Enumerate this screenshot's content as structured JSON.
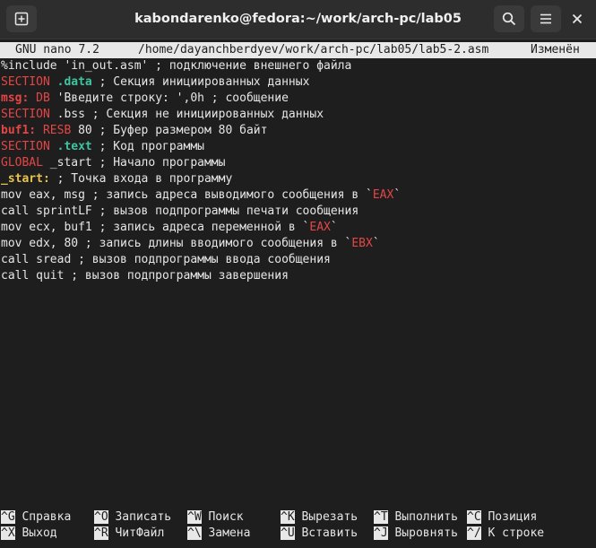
{
  "window": {
    "title": "kabondarenko@fedora:~/work/arch-pc/lab05",
    "new_tab_icon": "new-tab-icon",
    "search_icon": "search-icon",
    "menu_icon": "hamburger-menu-icon",
    "close_icon": "close-icon"
  },
  "nano": {
    "version": "GNU nano 7.2",
    "file_path": "/home/dayanchberdyev/work/arch-pc/lab05/lab5-2.asm",
    "status": "Изменён"
  },
  "code": {
    "l1": {
      "a": "%include 'in_out.asm' ; подключение внешнего файла"
    },
    "l2": {
      "a": "SECTION",
      "b": ".data",
      "c": " ; Секция инициированных данных"
    },
    "l3": {
      "a": "msg:",
      "b": " DB",
      "c": " 'Введите строку: ',0h ; сообщение"
    },
    "l4": {
      "a": "SECTION",
      "b": " .bss ; Секция не инициированных данных"
    },
    "l5": {
      "a": "buf1:",
      "b": " RESB",
      "c": " 80 ; Буфер размером 80 байт"
    },
    "l6": {
      "a": "SECTION",
      "b": ".text",
      "c": " ; Код программы"
    },
    "l7": {
      "a": "GLOBAL",
      "b": " _start ; Начало программы"
    },
    "l8": {
      "a": "_start:",
      "b": " ; Точка входа в программу"
    },
    "l9": {
      "a": "mov eax, msg ; запись адреса выводимого сообщения в `",
      "b": "EAX",
      "c": "`"
    },
    "l10": {
      "a": "call sprintLF ; вызов подпрограммы печати сообщения"
    },
    "l11": {
      "a": "mov ecx, buf1 ; запись адреса переменной в `",
      "b": "EAX",
      "c": "`"
    },
    "l12": {
      "a": "mov edx, 80 ; запись длины вводимого сообщения в `",
      "b": "EBX",
      "c": "`"
    },
    "l13": {
      "a": "call sread ; вызов подпрограммы ввода сообщения"
    },
    "l14": {
      "a": "call quit ; вызов подпрограммы завершения"
    }
  },
  "shortcuts": {
    "help": {
      "key": "^G",
      "label": "Справка"
    },
    "exit": {
      "key": "^X",
      "label": "Выход"
    },
    "write": {
      "key": "^O",
      "label": "Записать"
    },
    "read": {
      "key": "^R",
      "label": "ЧитФайл"
    },
    "where": {
      "key": "^W",
      "label": "Поиск"
    },
    "replace": {
      "key": "^\\",
      "label": "Замена"
    },
    "cut": {
      "key": "^K",
      "label": "Вырезать"
    },
    "paste": {
      "key": "^U",
      "label": "Вставить"
    },
    "execute": {
      "key": "^T",
      "label": "Выполнить"
    },
    "justify": {
      "key": "^J",
      "label": "Выровнять"
    },
    "location": {
      "key": "^C",
      "label": "Позиция"
    },
    "goto": {
      "key": "^/",
      "label": "К строке"
    }
  },
  "colors": {
    "keyword": "#e64545",
    "directive": "#3fc4a0",
    "label": "#e8c34a",
    "background": "#1e1e1e",
    "header_bg": "#e8e8e8"
  }
}
